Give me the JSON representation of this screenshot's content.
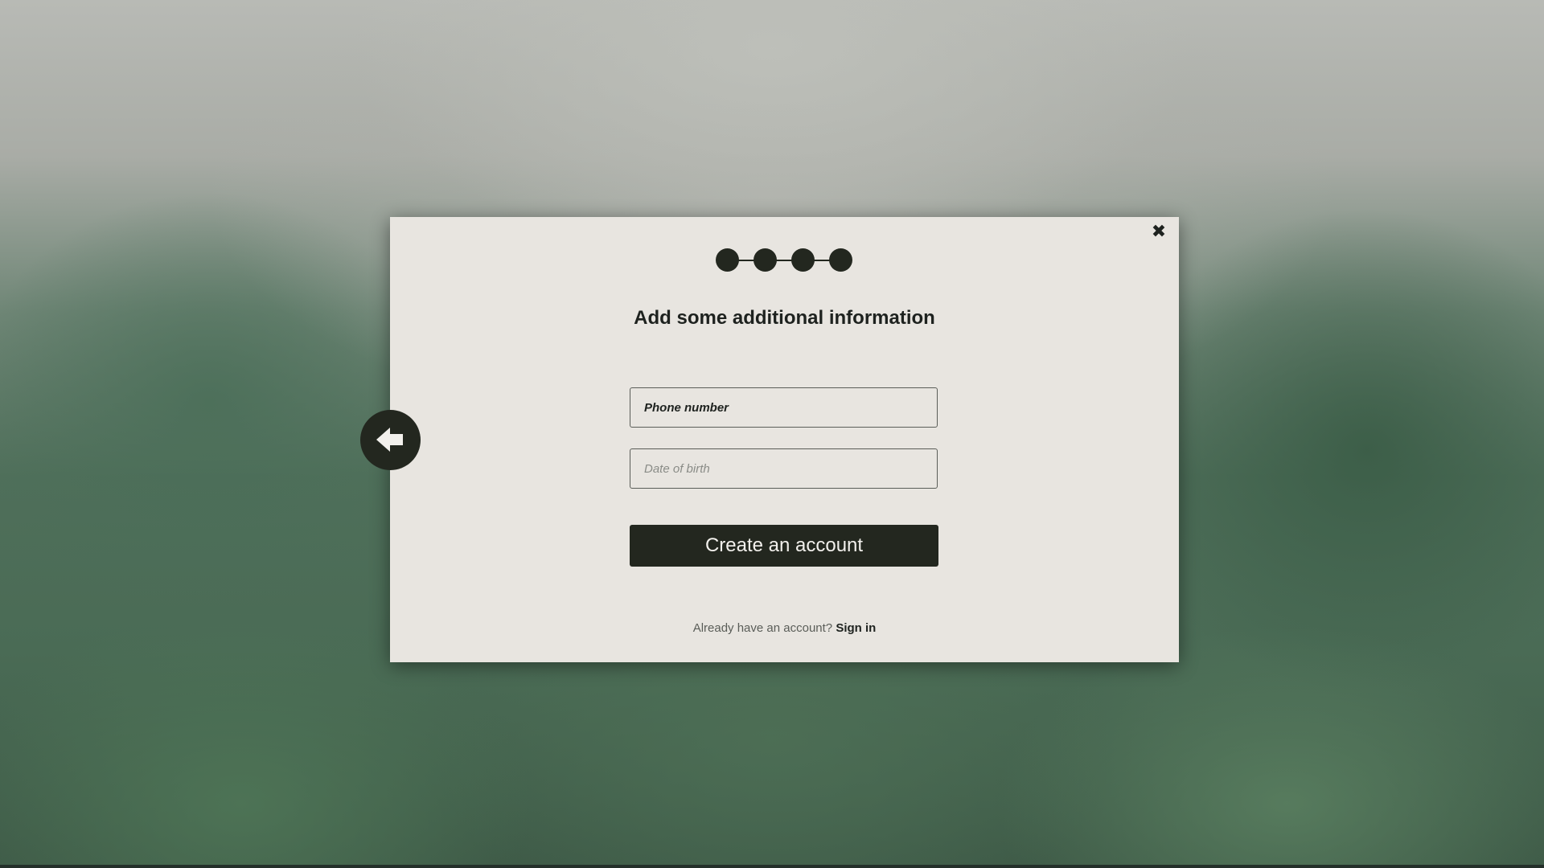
{
  "colors": {
    "accent": "#23271f",
    "modal_background": "#e8e5e0",
    "text_muted": "#5a5d58"
  },
  "progress": {
    "total_steps": 4,
    "step_labels": []
  },
  "modal": {
    "title": "Add some additional information",
    "close_icon": "close-icon",
    "fields": {
      "phone": {
        "placeholder": "Phone number",
        "value": ""
      },
      "dob": {
        "placeholder": "Date of birth",
        "value": ""
      }
    },
    "submit_label": "Create an account",
    "signin_prompt": "Already have an account?",
    "signin_link": "Sign in"
  },
  "back_button": {
    "icon": "arrow-left-icon"
  }
}
